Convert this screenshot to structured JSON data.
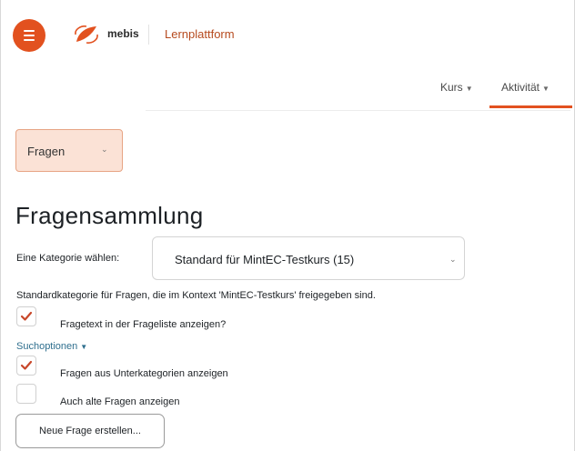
{
  "header": {
    "menu_icon": "hamburger-menu-icon",
    "logo_icon": "mebis-logo-icon",
    "brand": "mebis",
    "platform": "Lernplattform",
    "accent_color": "#e2511f"
  },
  "nav": {
    "items": [
      {
        "label": "Kurs",
        "active": false
      },
      {
        "label": "Aktivität",
        "active": true
      }
    ]
  },
  "page_select": {
    "label": "Fragen"
  },
  "main": {
    "title": "Fragensammlung",
    "category_label": "Eine Kategorie wählen:",
    "category_value": "Standard für MintEC-Testkurs (15)",
    "category_description": "Standardkategorie für Fragen, die im Kontext 'MintEC-Testkurs' freigegeben sind.",
    "options": [
      {
        "label": "Fragetext in der Frageliste anzeigen?",
        "checked": true
      },
      {
        "label": "Fragen aus Unterkategorien anzeigen",
        "checked": true
      },
      {
        "label": "Auch alte Fragen anzeigen",
        "checked": false
      }
    ],
    "search_options": "Suchoptionen",
    "new_question_button": "Neue Frage erstellen..."
  }
}
